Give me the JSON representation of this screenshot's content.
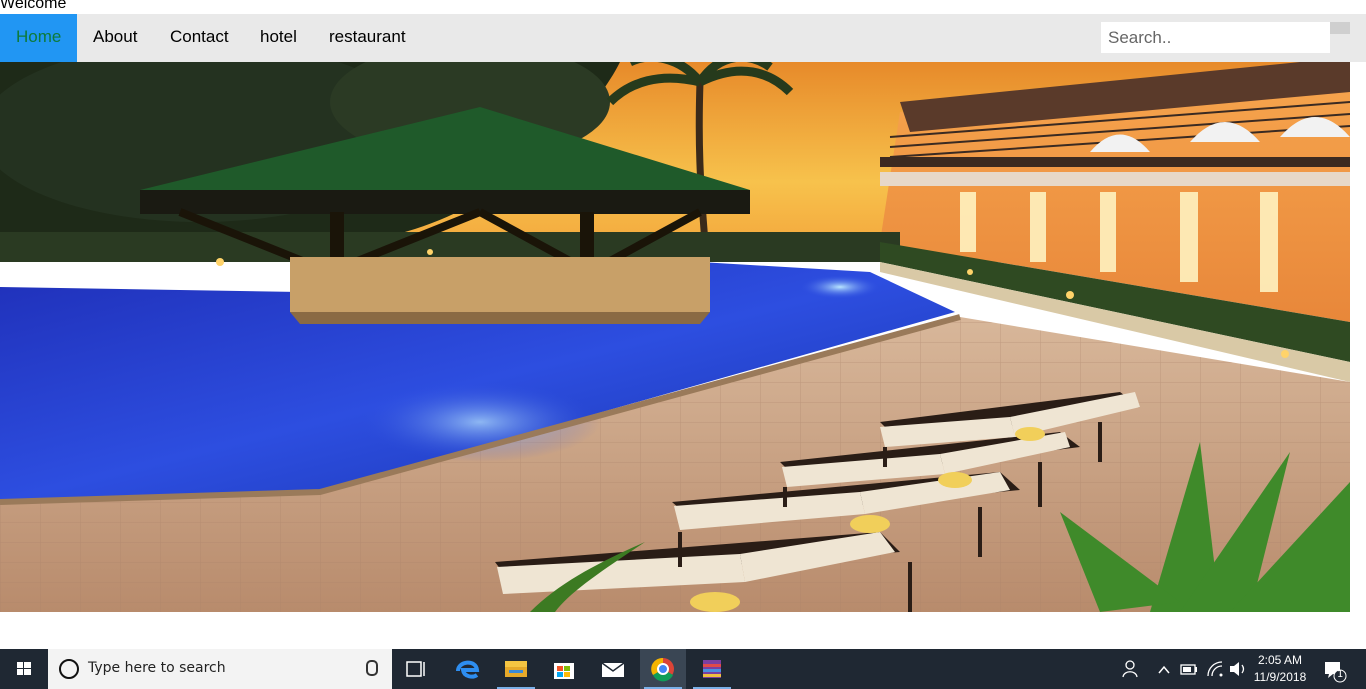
{
  "header": {
    "welcome": "Welcome"
  },
  "nav": {
    "items": [
      {
        "label": "Home",
        "active": true
      },
      {
        "label": "About"
      },
      {
        "label": "Contact"
      },
      {
        "label": "hotel"
      },
      {
        "label": "restaurant"
      }
    ],
    "search_placeholder": "Search.."
  },
  "colors": {
    "nav_bg": "#e9e9e9",
    "active_bg": "#2196f3",
    "active_text": "#0d7a3a",
    "taskbar_bg": "#1f2833"
  },
  "taskbar": {
    "search_placeholder": "Type here to search",
    "apps": [
      "task-view-icon",
      "edge-icon",
      "file-explorer-icon",
      "store-icon",
      "mail-icon",
      "chrome-icon",
      "winrar-icon"
    ],
    "time": "2:05 AM",
    "date": "11/9/2018",
    "notifications": "1"
  }
}
